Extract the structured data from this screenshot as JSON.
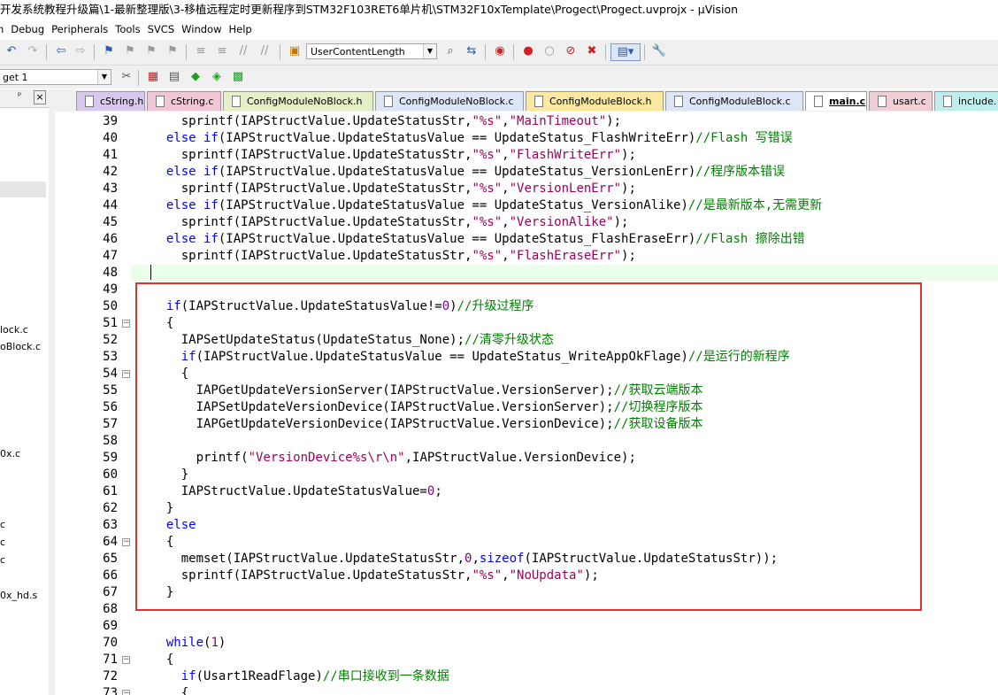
{
  "window": {
    "title": "开发系统教程升级篇\\1-最新整理版\\3-移植远程定时更新程序到STM32F103RET6单片机\\STM32F10xTemplate\\Progect\\Progect.uvprojx - µVision"
  },
  "menu": [
    "n",
    "Debug",
    "Peripherals",
    "Tools",
    "SVCS",
    "Window",
    "Help"
  ],
  "toolbar": {
    "find_combo_value": "UserContentLength",
    "target_combo_value": "get 1"
  },
  "sidebar": {
    "items": [
      {
        "label": "lock.c"
      },
      {
        "label": "oBlock.c"
      },
      {
        "label": "0x.c"
      },
      {
        "label": "c"
      },
      {
        "label": "c"
      },
      {
        "label": "c"
      },
      {
        "label": "0x_hd.s"
      }
    ],
    "pin": "ᵖ",
    "close": "×"
  },
  "tabs": [
    {
      "label": "cString.h",
      "color": "#d9c8ee"
    },
    {
      "label": "cString.c",
      "color": "#f2c6d6"
    },
    {
      "label": "ConfigModuleNoBlock.h",
      "color": "#e6f0c6"
    },
    {
      "label": "ConfigModuleNoBlock.c",
      "color": "#dde6f6"
    },
    {
      "label": "ConfigModuleBlock.h",
      "color": "#fbe9a2"
    },
    {
      "label": "ConfigModuleBlock.c",
      "color": "#dde6f6"
    },
    {
      "label": "main.c",
      "color": "#ffffff"
    },
    {
      "label": "usart.c",
      "color": "#f0cfd4"
    },
    {
      "label": "include.",
      "color": "#bfeeee"
    }
  ],
  "code": {
    "lines": [
      {
        "n": "39",
        "fold": "",
        "t": [
          [
            "",
            "    sprintf(IAPStructValue.UpdateStatusStr,"
          ],
          [
            "str",
            "\"%s\""
          ],
          [
            "",
            ","
          ],
          [
            "str",
            "\"MainTimeout\""
          ],
          [
            "",
            ");"
          ]
        ]
      },
      {
        "n": "40",
        "fold": "",
        "t": [
          [
            "kw",
            "  else if"
          ],
          [
            "",
            "(IAPStructValue.UpdateStatusValue == UpdateStatus_FlashWriteErr)"
          ],
          [
            "cmt",
            "//Flash 写错误"
          ]
        ]
      },
      {
        "n": "41",
        "fold": "",
        "t": [
          [
            "",
            "    sprintf(IAPStructValue.UpdateStatusStr,"
          ],
          [
            "str",
            "\"%s\""
          ],
          [
            "",
            ","
          ],
          [
            "str",
            "\"FlashWriteErr\""
          ],
          [
            "",
            ");"
          ]
        ]
      },
      {
        "n": "42",
        "fold": "",
        "t": [
          [
            "kw",
            "  else if"
          ],
          [
            "",
            "(IAPStructValue.UpdateStatusValue == UpdateStatus_VersionLenErr)"
          ],
          [
            "cmt",
            "//程序版本错误"
          ]
        ]
      },
      {
        "n": "43",
        "fold": "",
        "t": [
          [
            "",
            "    sprintf(IAPStructValue.UpdateStatusStr,"
          ],
          [
            "str",
            "\"%s\""
          ],
          [
            "",
            ","
          ],
          [
            "str",
            "\"VersionLenErr\""
          ],
          [
            "",
            ");"
          ]
        ]
      },
      {
        "n": "44",
        "fold": "",
        "t": [
          [
            "kw",
            "  else if"
          ],
          [
            "",
            "(IAPStructValue.UpdateStatusValue == UpdateStatus_VersionAlike)"
          ],
          [
            "cmt",
            "//是最新版本,无需更新"
          ]
        ]
      },
      {
        "n": "45",
        "fold": "",
        "t": [
          [
            "",
            "    sprintf(IAPStructValue.UpdateStatusStr,"
          ],
          [
            "str",
            "\"%s\""
          ],
          [
            "",
            ","
          ],
          [
            "str",
            "\"VersionAlike\""
          ],
          [
            "",
            ");"
          ]
        ]
      },
      {
        "n": "46",
        "fold": "",
        "t": [
          [
            "kw",
            "  else if"
          ],
          [
            "",
            "(IAPStructValue.UpdateStatusValue == UpdateStatus_FlashEraseErr)"
          ],
          [
            "cmt",
            "//Flash 擦除出错"
          ]
        ]
      },
      {
        "n": "47",
        "fold": "",
        "t": [
          [
            "",
            "    sprintf(IAPStructValue.UpdateStatusStr,"
          ],
          [
            "str",
            "\"%s\""
          ],
          [
            "",
            ","
          ],
          [
            "str",
            "\"FlashEraseErr\""
          ],
          [
            "",
            ");"
          ]
        ]
      },
      {
        "n": "48",
        "fold": "",
        "t": []
      },
      {
        "n": "49",
        "fold": "",
        "t": []
      },
      {
        "n": "50",
        "fold": "",
        "t": [
          [
            "kw",
            "  if"
          ],
          [
            "",
            "(IAPStructValue.UpdateStatusValue!="
          ],
          [
            "num",
            "0"
          ],
          [
            "",
            ")"
          ],
          [
            "cmt",
            "//升级过程序"
          ]
        ]
      },
      {
        "n": "51",
        "fold": "−",
        "t": [
          [
            "",
            "  {"
          ]
        ]
      },
      {
        "n": "52",
        "fold": "",
        "t": [
          [
            "",
            "    IAPSetUpdateStatus(UpdateStatus_None);"
          ],
          [
            "cmt",
            "//清零升级状态"
          ]
        ]
      },
      {
        "n": "53",
        "fold": "",
        "t": [
          [
            "kw",
            "    if"
          ],
          [
            "",
            "(IAPStructValue.UpdateStatusValue == UpdateStatus_WriteAppOkFlage)"
          ],
          [
            "cmt",
            "//是运行的新程序"
          ]
        ]
      },
      {
        "n": "54",
        "fold": "−",
        "t": [
          [
            "",
            "    {"
          ]
        ]
      },
      {
        "n": "55",
        "fold": "",
        "t": [
          [
            "",
            "      IAPGetUpdateVersionServer(IAPStructValue.VersionServer);"
          ],
          [
            "cmt",
            "//获取云端版本"
          ]
        ]
      },
      {
        "n": "56",
        "fold": "",
        "t": [
          [
            "",
            "      IAPSetUpdateVersionDevice(IAPStructValue.VersionServer);"
          ],
          [
            "cmt",
            "//切换程序版本"
          ]
        ]
      },
      {
        "n": "57",
        "fold": "",
        "t": [
          [
            "",
            "      IAPGetUpdateVersionDevice(IAPStructValue.VersionDevice);"
          ],
          [
            "cmt",
            "//获取设备版本"
          ]
        ]
      },
      {
        "n": "58",
        "fold": "",
        "t": []
      },
      {
        "n": "59",
        "fold": "",
        "t": [
          [
            "",
            "      printf("
          ],
          [
            "str",
            "\"VersionDevice%s\\r\\n\""
          ],
          [
            "",
            ",IAPStructValue.VersionDevice);"
          ]
        ]
      },
      {
        "n": "60",
        "fold": "",
        "t": [
          [
            "",
            "    }"
          ]
        ]
      },
      {
        "n": "61",
        "fold": "",
        "t": [
          [
            "",
            "    IAPStructValue.UpdateStatusValue="
          ],
          [
            "num",
            "0"
          ],
          [
            "",
            ";"
          ]
        ]
      },
      {
        "n": "62",
        "fold": "",
        "t": [
          [
            "",
            "  }"
          ]
        ]
      },
      {
        "n": "63",
        "fold": "",
        "t": [
          [
            "kw",
            "  else"
          ]
        ]
      },
      {
        "n": "64",
        "fold": "−",
        "t": [
          [
            "",
            "  {"
          ]
        ]
      },
      {
        "n": "65",
        "fold": "",
        "t": [
          [
            "",
            "    memset(IAPStructValue.UpdateStatusStr,"
          ],
          [
            "num",
            "0"
          ],
          [
            "",
            ","
          ],
          [
            "kw",
            "sizeof"
          ],
          [
            "",
            "(IAPStructValue.UpdateStatusStr));"
          ]
        ]
      },
      {
        "n": "66",
        "fold": "",
        "t": [
          [
            "",
            "    sprintf(IAPStructValue.UpdateStatusStr,"
          ],
          [
            "str",
            "\"%s\""
          ],
          [
            "",
            ","
          ],
          [
            "str",
            "\"NoUpdata\""
          ],
          [
            "",
            ");"
          ]
        ]
      },
      {
        "n": "67",
        "fold": "",
        "t": [
          [
            "",
            "  }"
          ]
        ]
      },
      {
        "n": "68",
        "fold": "",
        "t": []
      },
      {
        "n": "69",
        "fold": "",
        "t": []
      },
      {
        "n": "70",
        "fold": "",
        "t": [
          [
            "kw",
            "  while"
          ],
          [
            "",
            "("
          ],
          [
            "num",
            "1"
          ],
          [
            "",
            ")"
          ]
        ]
      },
      {
        "n": "71",
        "fold": "−",
        "t": [
          [
            "",
            "  {"
          ]
        ]
      },
      {
        "n": "72",
        "fold": "",
        "t": [
          [
            "kw",
            "    if"
          ],
          [
            "",
            "(Usart1ReadFlage)"
          ],
          [
            "cmt",
            "//串口接收到一条数据"
          ]
        ]
      },
      {
        "n": "73",
        "fold": "−",
        "t": [
          [
            "",
            "    {"
          ]
        ]
      }
    ]
  },
  "colors": {
    "highlight_box": "#e03030",
    "keyword": "#0000ff",
    "string": "#a0005a",
    "comment": "#008000",
    "number": "#800080"
  }
}
